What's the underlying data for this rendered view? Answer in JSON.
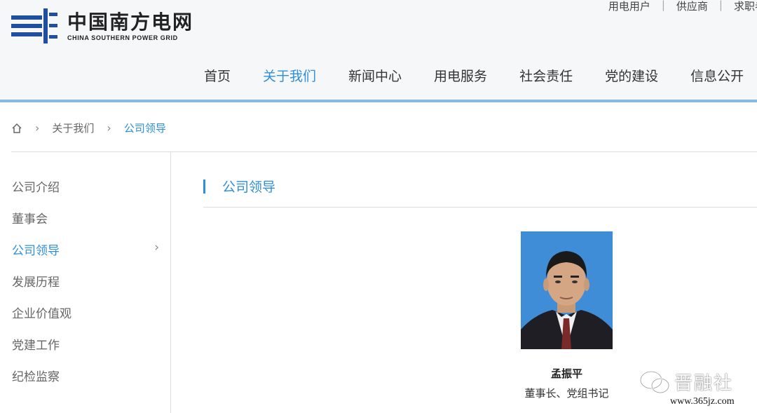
{
  "brand": {
    "name_cn": "中国南方电网",
    "name_en": "CHINA SOUTHERN POWER GRID",
    "accent_color": "#2e8fd8",
    "logo_icon": "power-lines-logo"
  },
  "top_links": [
    "用电用户",
    "供应商",
    "求职者"
  ],
  "nav": {
    "items": [
      "首页",
      "关于我们",
      "新闻中心",
      "用电服务",
      "社会责任",
      "党的建设",
      "信息公开"
    ],
    "active": "关于我们"
  },
  "breadcrumb": {
    "home_icon": "home-icon",
    "items": [
      "关于我们",
      "公司领导"
    ]
  },
  "sidebar": {
    "items": [
      {
        "label": "公司介绍",
        "active": false
      },
      {
        "label": "董事会",
        "active": false
      },
      {
        "label": "公司领导",
        "active": true
      },
      {
        "label": "发展历程",
        "active": false
      },
      {
        "label": "企业价值观",
        "active": false
      },
      {
        "label": "党建工作",
        "active": false
      },
      {
        "label": "纪检监察",
        "active": false
      }
    ]
  },
  "content": {
    "section_title": "公司领导",
    "leader": {
      "name": "孟振平",
      "title": "董事长、党组书记"
    }
  },
  "watermark": {
    "text": "晋融社",
    "url": "www.365jz.com",
    "icon": "wechat-icon"
  }
}
